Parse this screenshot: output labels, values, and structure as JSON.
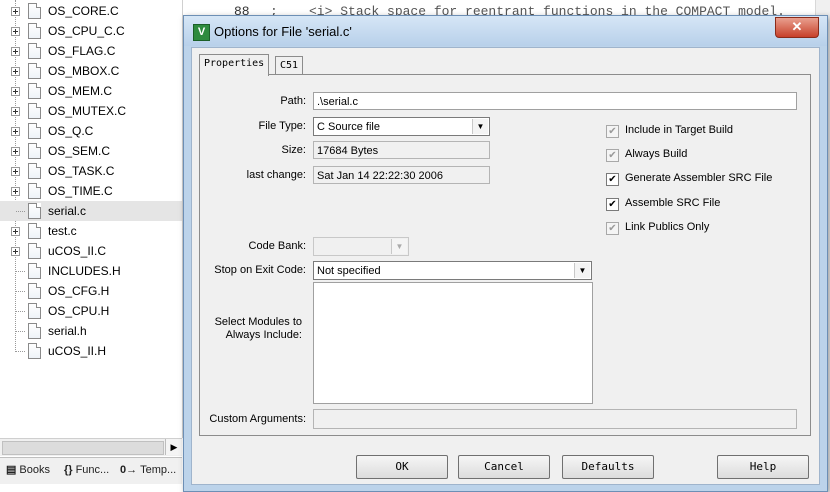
{
  "tree": {
    "items": [
      {
        "label": "OS_CORE.C",
        "expandable": true
      },
      {
        "label": "OS_CPU_C.C",
        "expandable": true
      },
      {
        "label": "OS_FLAG.C",
        "expandable": true
      },
      {
        "label": "OS_MBOX.C",
        "expandable": true
      },
      {
        "label": "OS_MEM.C",
        "expandable": true
      },
      {
        "label": "OS_MUTEX.C",
        "expandable": true
      },
      {
        "label": "OS_Q.C",
        "expandable": true
      },
      {
        "label": "OS_SEM.C",
        "expandable": true
      },
      {
        "label": "OS_TASK.C",
        "expandable": true
      },
      {
        "label": "OS_TIME.C",
        "expandable": true
      },
      {
        "label": "serial.c",
        "expandable": false,
        "selected": true
      },
      {
        "label": "test.c",
        "expandable": true
      },
      {
        "label": "uCOS_II.C",
        "expandable": true
      },
      {
        "label": "INCLUDES.H",
        "expandable": false
      },
      {
        "label": "OS_CFG.H",
        "expandable": false
      },
      {
        "label": "OS_CPU.H",
        "expandable": false
      },
      {
        "label": "serial.h",
        "expandable": false
      },
      {
        "label": "uCOS_II.H",
        "expandable": false
      }
    ]
  },
  "project_tabs": [
    {
      "icon": "books-icon",
      "glyph": "▤",
      "label": "Books"
    },
    {
      "icon": "functions-icon",
      "glyph": "{}",
      "label": "Func..."
    },
    {
      "icon": "templates-icon",
      "glyph": "0→",
      "label": "Temp..."
    }
  ],
  "editor": {
    "line_number": "88",
    "code": ";    <i> Stack space for reentrant functions in the COMPACT model."
  },
  "dialog": {
    "title": "Options for File 'serial.c'",
    "close_glyph": "✕",
    "tabs": [
      "Properties",
      "C51"
    ],
    "active_tab": "Properties",
    "path_label": "Path:",
    "path_value": ".\\serial.c",
    "file_type_label": "File Type:",
    "file_type_value": "C Source file",
    "size_label": "Size:",
    "size_value": "17684 Bytes",
    "last_change_label": "last change:",
    "last_change_value": "Sat Jan 14 22:22:30 2006",
    "code_bank_label": "Code Bank:",
    "code_bank_value": "",
    "stop_label": "Stop on Exit Code:",
    "stop_value": "Not specified",
    "select_modules_label": "Select Modules to Always Include:",
    "custom_args_label": "Custom Arguments:",
    "custom_args_value": "",
    "checkboxes": [
      {
        "label": "Include in Target Build",
        "checked": true,
        "enabled": false
      },
      {
        "label": "Always Build",
        "checked": true,
        "enabled": false
      },
      {
        "label": "Generate Assembler SRC File",
        "checked": true,
        "enabled": true
      },
      {
        "label": "Assemble SRC File",
        "checked": true,
        "enabled": true
      },
      {
        "label": "Link Publics Only",
        "checked": true,
        "enabled": false
      }
    ],
    "buttons": {
      "ok": "OK",
      "cancel": "Cancel",
      "defaults": "Defaults",
      "help": "Help"
    }
  }
}
